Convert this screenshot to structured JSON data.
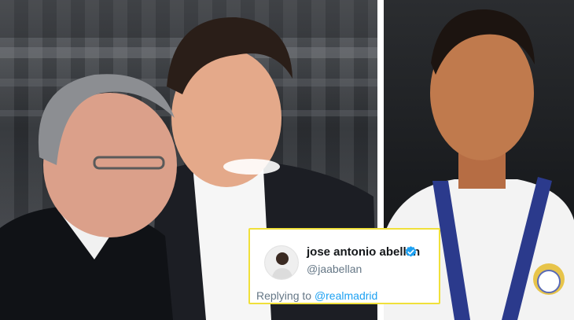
{
  "photos": {
    "left": {
      "alt": ""
    },
    "right": {
      "alt": ""
    }
  },
  "tweet": {
    "display_name": "jose antonio abellan",
    "handle": "@jaabellan",
    "replying_prefix": "Replying to",
    "replying_mention": "@realmadrid",
    "verified": true,
    "icons": {
      "verified": "verified-badge-icon",
      "avatar": "avatar-photo"
    }
  },
  "colors": {
    "card_border": "#f0e03a",
    "handle_gray": "#657786",
    "mention_blue": "#1da1f2",
    "verified_blue": "#1da1f2"
  }
}
